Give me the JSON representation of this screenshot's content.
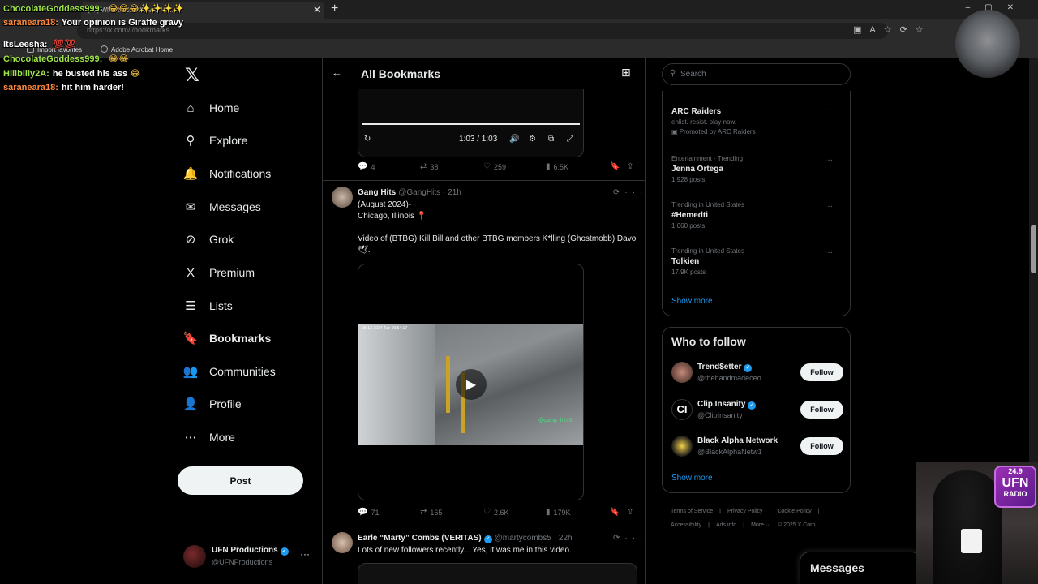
{
  "browser": {
    "tab_title": "(73) What is Not Allowed / W...",
    "address": "https://x.com/i/bookmarks",
    "favorites": [
      {
        "label": "Import favorites"
      },
      {
        "label": "Adobe Acrobat Home"
      }
    ]
  },
  "chat": [
    {
      "user": "ChocolateGoddess999:",
      "msg": "",
      "emotes": "😂😂😂✨✨✨✨",
      "color": "#9ee34c"
    },
    {
      "user": "saraneara18:",
      "msg": "Your opinion is Giraffe gravy",
      "emotes": "",
      "color": "#ff8a3c"
    },
    {
      "user": "ItsLeesha:",
      "msg": "",
      "emotes": "💯💯",
      "color": "#ffffff"
    },
    {
      "user": "ChocolateGoddess999:",
      "msg": "",
      "emotes": "😂😂",
      "color": "#9ee34c"
    },
    {
      "user": "Hillbilly2A:",
      "msg": "he busted his ass",
      "emotes": "😂",
      "color": "#9ee34c"
    },
    {
      "user": "saraneara18:",
      "msg": "hit him harder!",
      "emotes": "",
      "color": "#ff8a3c"
    }
  ],
  "nav": {
    "items": [
      {
        "label": "Home",
        "icon": "⌂"
      },
      {
        "label": "Explore",
        "icon": "⚲"
      },
      {
        "label": "Notifications",
        "icon": "🔔"
      },
      {
        "label": "Messages",
        "icon": "✉"
      },
      {
        "label": "Grok",
        "icon": "⊘"
      },
      {
        "label": "Premium",
        "icon": "X"
      },
      {
        "label": "Lists",
        "icon": "☰"
      },
      {
        "label": "Bookmarks",
        "icon": "🔖"
      },
      {
        "label": "Communities",
        "icon": "👥"
      },
      {
        "label": "Profile",
        "icon": "👤"
      },
      {
        "label": "More",
        "icon": "⋯"
      }
    ],
    "post_label": "Post",
    "account": {
      "name": "UFN Productions",
      "handle": "@UFNProductions"
    }
  },
  "header": {
    "title": "All Bookmarks"
  },
  "video_top": {
    "time": "1:03 / 1:03"
  },
  "tweet1_stats": {
    "replies": "4",
    "reposts": "38",
    "likes": "259",
    "views": "6.5K"
  },
  "tweet2": {
    "name": "Gang Hits",
    "handle": "@GangHits",
    "time": "· 21h",
    "text": "(August 2024)-\nChicago, Illinois 📍\n\nVideo of (BTBG) Kill Bill and other BTBG members K*lling (Ghostmobb) Davo 🕊.",
    "video_timestamp": "08-13-2024 Tue 00:54:17",
    "watermark": "@gang_hits3",
    "stats": {
      "replies": "71",
      "reposts": "165",
      "likes": "2.6K",
      "views": "179K"
    }
  },
  "tweet3": {
    "name": "Earle “Marty” Combs (VERITAS)",
    "handle": "@martycombs5",
    "time": "· 22h",
    "text": "Lots of new followers recently... Yes, it was me in this video."
  },
  "search": {
    "placeholder": "Search"
  },
  "trends": [
    {
      "meta": "",
      "title": "ARC Raiders",
      "sub": "enlist. resist. play now.",
      "promo": "Promoted by ARC Raiders"
    },
    {
      "meta": "Entertainment · Trending",
      "title": "Jenna Ortega",
      "sub": "1,928 posts",
      "promo": ""
    },
    {
      "meta": "Trending in United States",
      "title": "#Hemedti",
      "sub": "1,060 posts",
      "promo": ""
    },
    {
      "meta": "Trending in United States",
      "title": "Tolkien",
      "sub": "17.9K posts",
      "promo": ""
    }
  ],
  "show_more": "Show more",
  "who_to_follow": {
    "title": "Who to follow",
    "accounts": [
      {
        "name": "Trend$etter",
        "handle": "@thehandmadeceo",
        "button": "Follow"
      },
      {
        "name": "Clip Insanity",
        "handle": "@ClipInsanity",
        "button": "Follow"
      },
      {
        "name": "Black Alpha Network",
        "handle": "@BlackAlphaNetw1",
        "button": "Follow"
      }
    ]
  },
  "footer_links": [
    "Terms of Service",
    "|",
    "Privacy Policy",
    "|",
    "Cookie Policy",
    "|",
    "Accessibility",
    "|",
    "Ads info",
    "|",
    "More ···",
    "© 2025 X Corp."
  ],
  "messages_drawer": "Messages",
  "ufn_badge": {
    "freq": "24.9",
    "name": "UFN",
    "radio": "RADIO"
  }
}
